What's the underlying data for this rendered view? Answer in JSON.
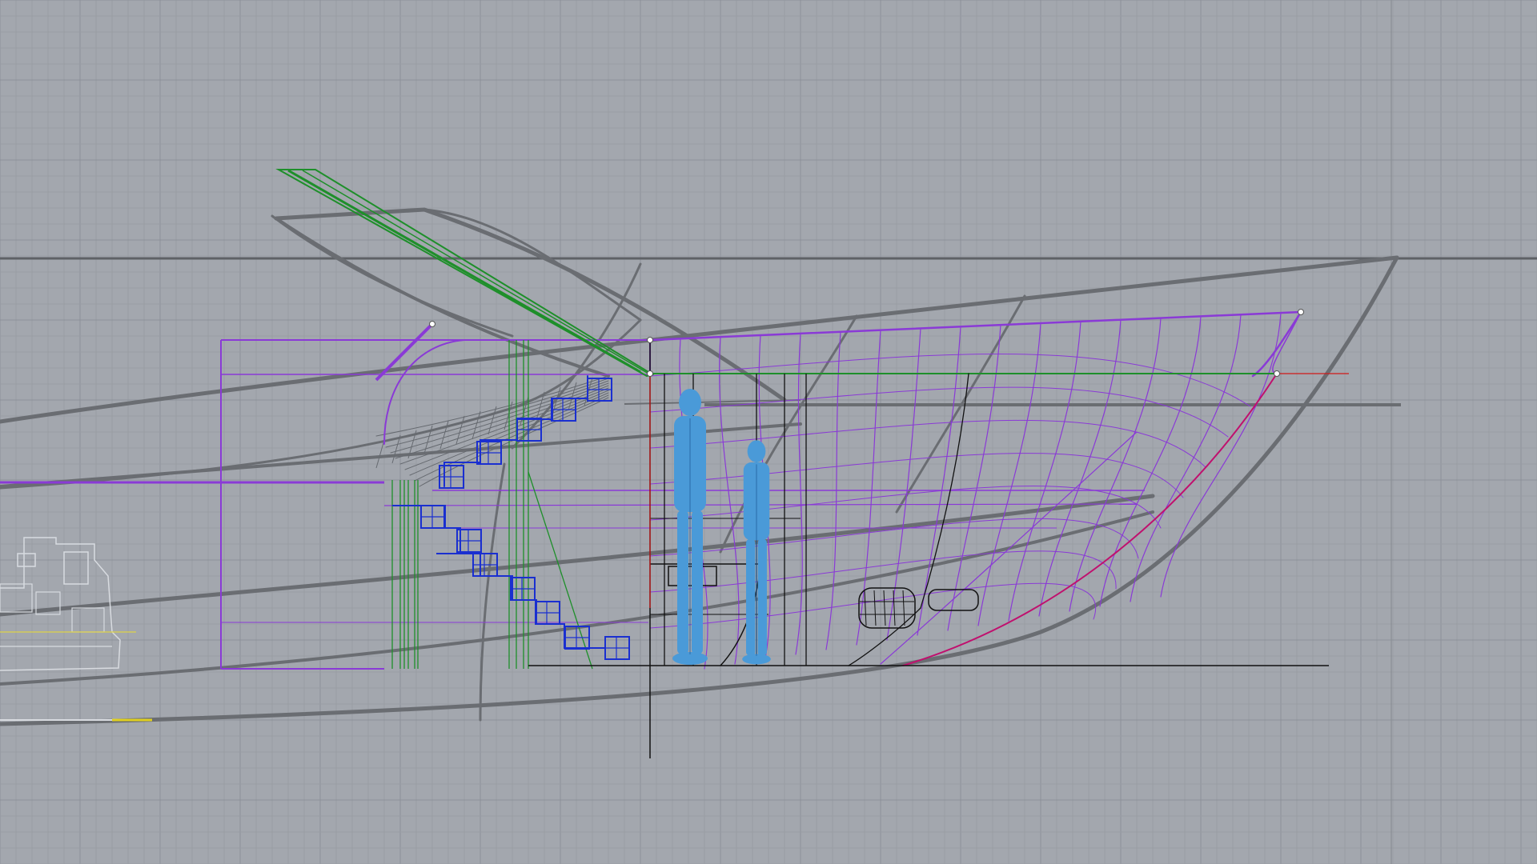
{
  "app": {
    "view": "cad-modeling-viewport",
    "content": "sailboat-hull-wireframe-side-elevation"
  },
  "colors": {
    "background": "#a3a7ae",
    "grid_minor": "#999da4",
    "grid_major": "#8c9199",
    "reference_lines": "#5e6166",
    "hull_lines": "#6a6d72",
    "purple_construction": "#8a3ad6",
    "green_curves": "#1e8f2a",
    "blue_stairs": "#1a2fd0",
    "black_lines": "#111111",
    "magenta_curve": "#c0106e",
    "red_axis": "#d01818",
    "figure_fill": "#4a9ad8",
    "engine_sketch": "#d8dbe0",
    "yellow_marker": "#e0d020"
  },
  "objects": {
    "human_figures": 2,
    "stair_steps": 10,
    "control_points": 5
  }
}
